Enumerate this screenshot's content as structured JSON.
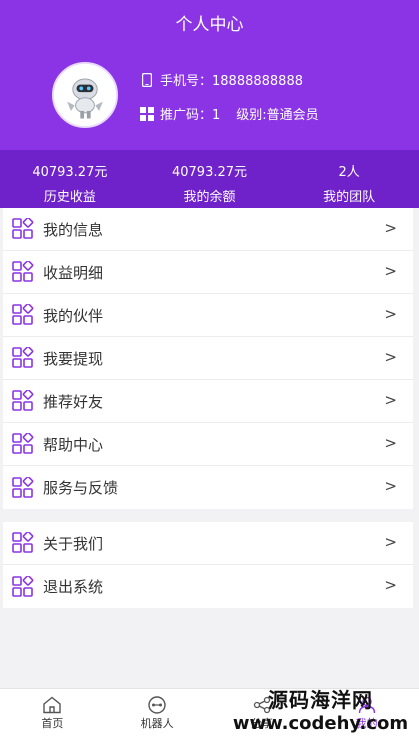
{
  "header": {
    "title": "个人中心",
    "phone_label": "手机号：18888888888",
    "invite_code": "推广码：1",
    "level": "级别:普通会员"
  },
  "stats": [
    {
      "value": "40793.27元",
      "label": "历史收益"
    },
    {
      "value": "40793.27元",
      "label": "我的余额"
    },
    {
      "value": "2人",
      "label": "我的团队"
    }
  ],
  "menu_main": [
    {
      "label": "我的信息"
    },
    {
      "label": "收益明细"
    },
    {
      "label": "我的伙伴"
    },
    {
      "label": "我要提现"
    },
    {
      "label": "推荐好友"
    },
    {
      "label": "帮助中心"
    },
    {
      "label": "服务与反馈"
    }
  ],
  "menu_secondary": [
    {
      "label": "关于我们"
    },
    {
      "label": "退出系统"
    }
  ],
  "arrow": ">",
  "tabs": [
    {
      "label": "首页",
      "icon": "home-icon"
    },
    {
      "label": "机器人",
      "icon": "robot-icon"
    },
    {
      "label": "分享",
      "icon": "share-icon"
    },
    {
      "label": "我的",
      "icon": "user-icon",
      "active": true
    }
  ],
  "watermark": {
    "line1": "源码海洋网",
    "line2": "www.codehy.com"
  },
  "colors": {
    "accent": "#8a34e6",
    "stats_bg": "#6f22c9"
  }
}
